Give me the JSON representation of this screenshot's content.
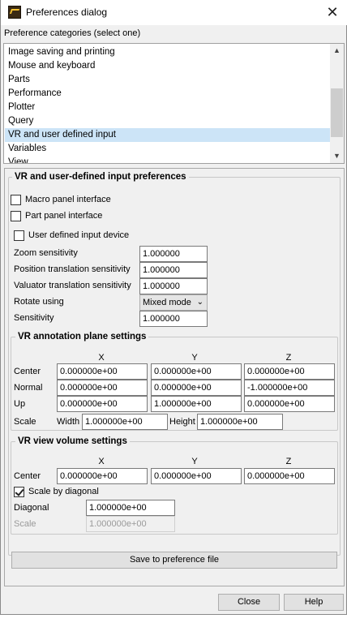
{
  "window": {
    "title": "Preferences dialog",
    "close_glyph": "✕"
  },
  "categories": {
    "label": "Preference categories (select one)",
    "items": [
      "Image saving and printing",
      "Mouse and keyboard",
      "Parts",
      "Performance",
      "Plotter",
      "Query",
      "VR and user defined input",
      "Variables",
      "View"
    ],
    "selected": "VR and user defined input"
  },
  "vr_panel": {
    "title": "VR and user-defined input preferences",
    "macro_panel_label": "Macro panel interface",
    "part_panel_label": "Part panel interface",
    "user_defined_label": "User defined input device",
    "zoom": {
      "label": "Zoom sensitivity",
      "value": "1.000000"
    },
    "position": {
      "label": "Position translation sensitivity",
      "value": "1.000000"
    },
    "valuator": {
      "label": "Valuator translation sensitivity",
      "value": "1.000000"
    },
    "rotate": {
      "label": "Rotate using",
      "value": "Mixed mode"
    },
    "sensitivity": {
      "label": "Sensitivity",
      "value": "1.000000"
    }
  },
  "annotation": {
    "title": "VR annotation plane settings",
    "headers": {
      "x": "X",
      "y": "Y",
      "z": "Z"
    },
    "center": {
      "label": "Center",
      "x": "0.000000e+00",
      "y": "0.000000e+00",
      "z": "0.000000e+00"
    },
    "normal": {
      "label": "Normal",
      "x": "0.000000e+00",
      "y": "0.000000e+00",
      "z": "-1.000000e+00"
    },
    "up": {
      "label": "Up",
      "x": "0.000000e+00",
      "y": "1.000000e+00",
      "z": "0.000000e+00"
    },
    "scale": {
      "label": "Scale",
      "width_label": "Width",
      "width": "1.000000e+00",
      "height_label": "Height",
      "height": "1.000000e+00"
    }
  },
  "view_volume": {
    "title": "VR view volume settings",
    "headers": {
      "x": "X",
      "y": "Y",
      "z": "Z"
    },
    "center": {
      "label": "Center",
      "x": "0.000000e+00",
      "y": "0.000000e+00",
      "z": "0.000000e+00"
    },
    "scale_by_diagonal_label": "Scale by diagonal",
    "diagonal": {
      "label": "Diagonal",
      "value": "1.000000e+00"
    },
    "scale": {
      "label": "Scale",
      "value": "1.000000e+00"
    }
  },
  "buttons": {
    "save": "Save to preference file",
    "close": "Close",
    "help": "Help"
  }
}
